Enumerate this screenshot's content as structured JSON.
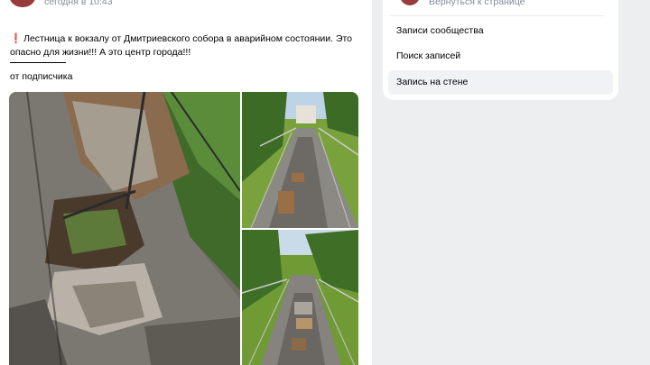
{
  "post": {
    "time": "сегодня в 10:43",
    "text_line1": "Лестница к вокзалу от Дмитриевского собора в аварийном состоянии. Это",
    "text_line2": "опасно для жизни!!! А это центр города!!!",
    "warning_icon": "exclamation-icon",
    "from": "от подписчика"
  },
  "sidebar": {
    "back_label": "Вернуться к странице",
    "items": [
      {
        "label": "Записи сообщества"
      },
      {
        "label": "Поиск записей"
      },
      {
        "label": "Запись на стене"
      }
    ],
    "active_index": 2
  },
  "colors": {
    "background": "#edeef0",
    "card": "#ffffff",
    "secondary_text": "#818c99",
    "warning": "#e64646",
    "active_item": "#f0f2f5"
  }
}
